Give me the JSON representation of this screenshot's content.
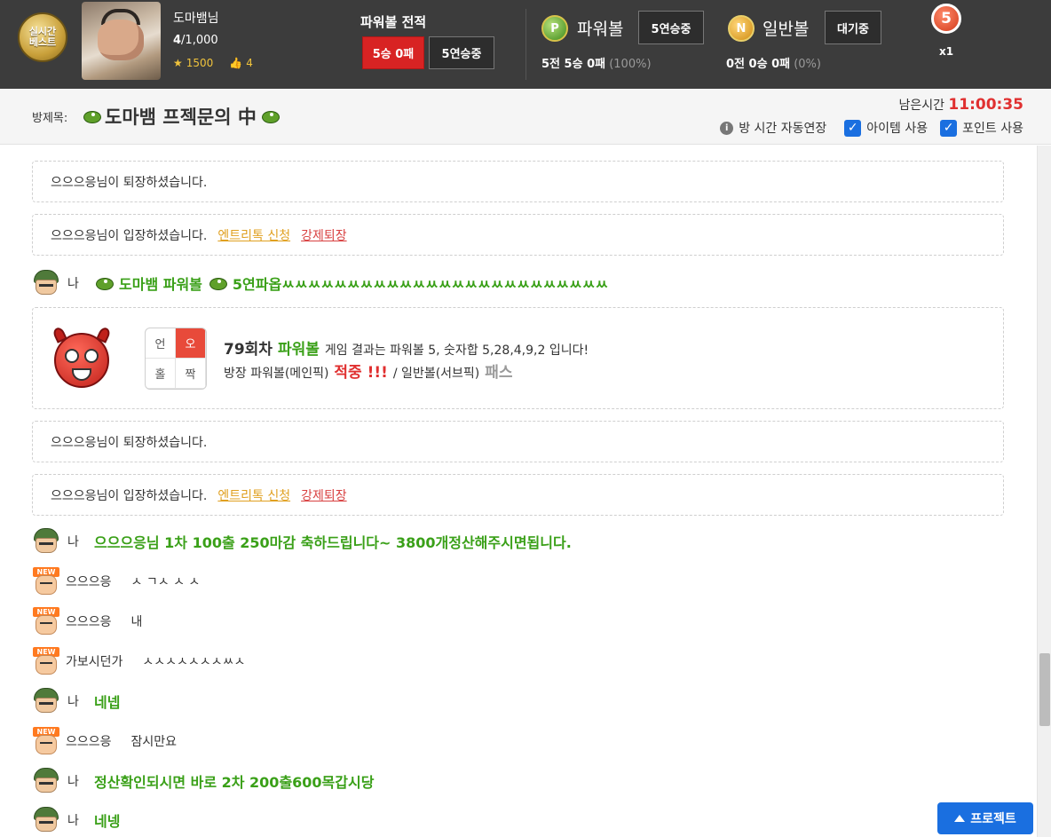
{
  "header": {
    "badge_line1": "실시간",
    "badge_line2": "베스트",
    "nickname": "도마뱀님",
    "rank": "4",
    "rank_total": "/1,000",
    "stars": "1500",
    "likes": "4",
    "record_title": "파워볼 전적",
    "record_score": "5승 0패",
    "record_streak": "5연승중",
    "powerball": {
      "label": "파워볼",
      "ball": "P",
      "streak": "5연승중",
      "stat_main": "5전 5승 0패",
      "stat_pct": "(100%)"
    },
    "normalball": {
      "label": "일반볼",
      "ball": "N",
      "streak": "대기중",
      "stat_main": "0전 0승 0패",
      "stat_pct": "(0%)"
    },
    "ball_count": "5",
    "ball_multiplier": "x1"
  },
  "room": {
    "label": "방제목:",
    "title": "도마뱀 프젝문의 中",
    "remain_label": "남은시간",
    "remain_time": "11:00:35",
    "opt_extend": "방 시간 자동연장",
    "opt_item": "아이템 사용",
    "opt_point": "포인트 사용"
  },
  "chat": {
    "sys1": "으으으응님이 퇴장하셨습니다.",
    "sys2": "으으으응님이 입장하셨습니다.",
    "sys2_link1": "엔트리톡 신청",
    "sys2_link2": "강제퇴장",
    "me_label": "나",
    "msg1_a": "도마뱀 파워볼",
    "msg1_b": "5연파옵ㅆㅆㅆㅆㅆㅆㅆㅆㅆㅆㅆㅆㅆㅆㅆㅆㅆㅆㅆㅆㅆㅆㅆㅆㅆ",
    "result": {
      "cell_1": "언",
      "cell_2": "오",
      "cell_3": "홀",
      "cell_4": "짝",
      "round": "79회차",
      "game": "파워볼",
      "line1_rest": "게임 결과는 파워볼 5, 숫자합 5,28,4,9,2 입니다!",
      "line2_a": "방장 파워볼(메인픽)",
      "line2_hit": "적중 !!!",
      "line2_b": "/ 일반볼(서브픽)",
      "line2_pass": "패스"
    },
    "sys3": "으으으응님이 퇴장하셨습니다.",
    "sys4": "으으으응님이 입장하셨습니다.",
    "sys4_link1": "엔트리톡 신청",
    "sys4_link2": "강제퇴장",
    "msg2": "으으으응님 1차 100출 250마감 축하드립니다~ 3800개정산해주시면됩니다.",
    "u1_name": "으으으응",
    "u1_text": "ㅅ ㄱㅅ ㅅ ㅅ",
    "u2_name": "으으으응",
    "u2_text": "내",
    "u3_name": "가보시던가",
    "u3_text": "ㅅㅅㅅㅅㅅㅅㅅㅆㅅ",
    "msg3": "네넵",
    "u4_name": "으으으응",
    "u4_text": "잠시만요",
    "msg4": "정산확인되시면 바로 2차 200출600목갑시당",
    "msg5": "네넹"
  },
  "project_button": "프로젝트",
  "colors": {
    "accent_blue": "#1a6fe0",
    "red": "#d82323",
    "green_text": "#3aa018",
    "header_bg": "#3c3c3c"
  }
}
